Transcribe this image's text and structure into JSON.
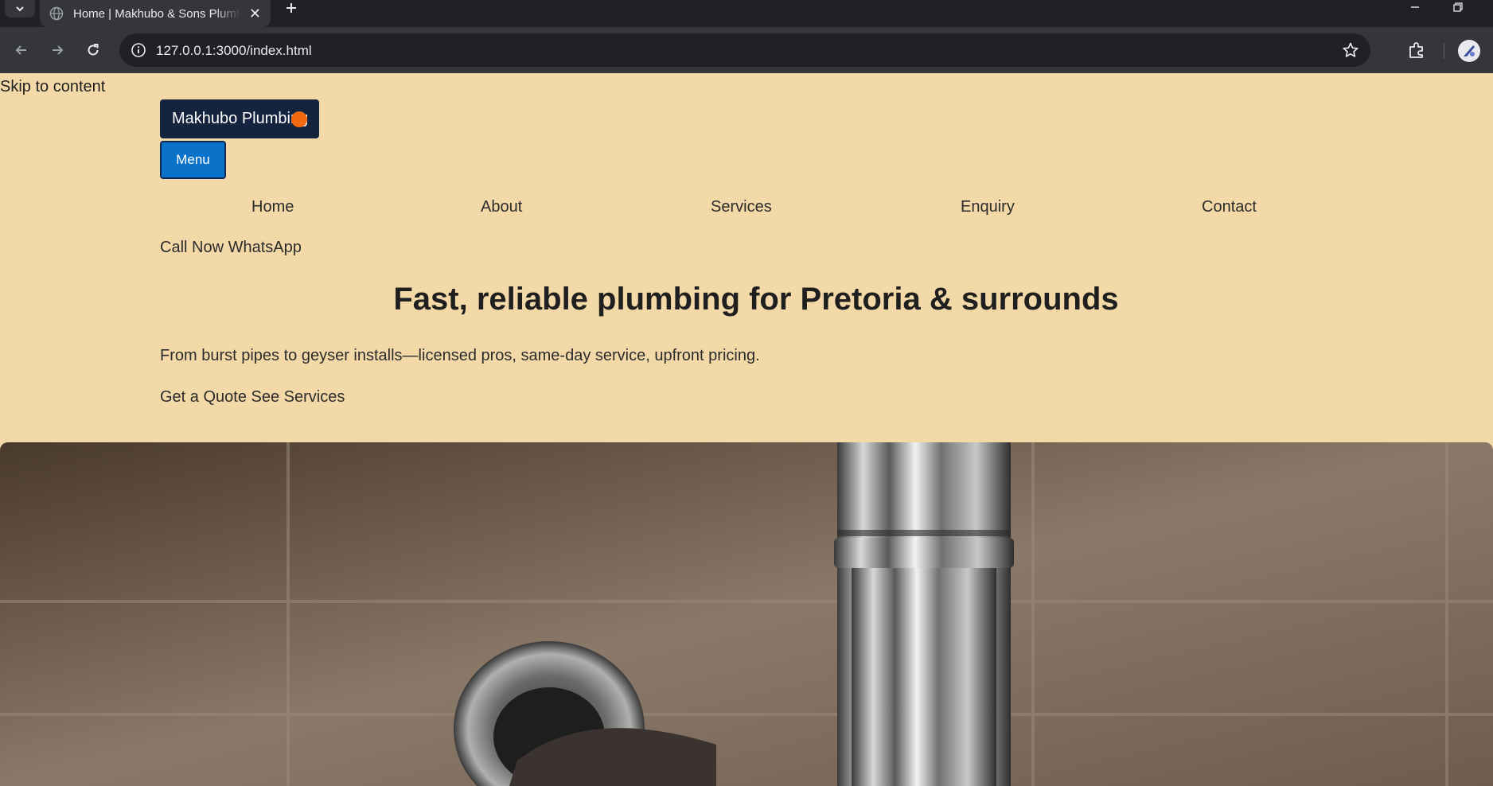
{
  "browser": {
    "tab_title": "Home | Makhubo & Sons Plumbing",
    "url": "127.0.0.1:3000/index.html"
  },
  "page": {
    "skip_link": "Skip to content",
    "brand": "Makhubo Plumbing",
    "menu_button": "Menu",
    "nav": [
      {
        "label": "Home"
      },
      {
        "label": "About"
      },
      {
        "label": "Services"
      },
      {
        "label": "Enquiry"
      },
      {
        "label": "Contact"
      }
    ],
    "cta": {
      "call": "Call Now",
      "whatsapp": "WhatsApp"
    },
    "hero": {
      "headline": "Fast, reliable plumbing for Pretoria & surrounds",
      "lead": "From burst pipes to geyser installs—licensed pros, same-day service, upfront pricing.",
      "quote_link": "Get a Quote",
      "services_link": "See Services",
      "image_alt": "chrome-sink-pipe-photo"
    }
  },
  "colors": {
    "page_bg": "#f3d9a8",
    "brand_bg": "#14243f",
    "brand_dot": "#f26a10",
    "menu_bg": "#0b72c9",
    "chrome_dark": "#202124",
    "chrome_toolbar": "#35363a"
  },
  "icons": [
    "tab-search-icon",
    "globe-favicon-icon",
    "close-icon",
    "plus-icon",
    "minimize-icon",
    "restore-icon",
    "back-arrow-icon",
    "forward-arrow-icon",
    "reload-icon",
    "site-info-icon",
    "star-icon",
    "extensions-icon",
    "profile-avatar-icon"
  ]
}
